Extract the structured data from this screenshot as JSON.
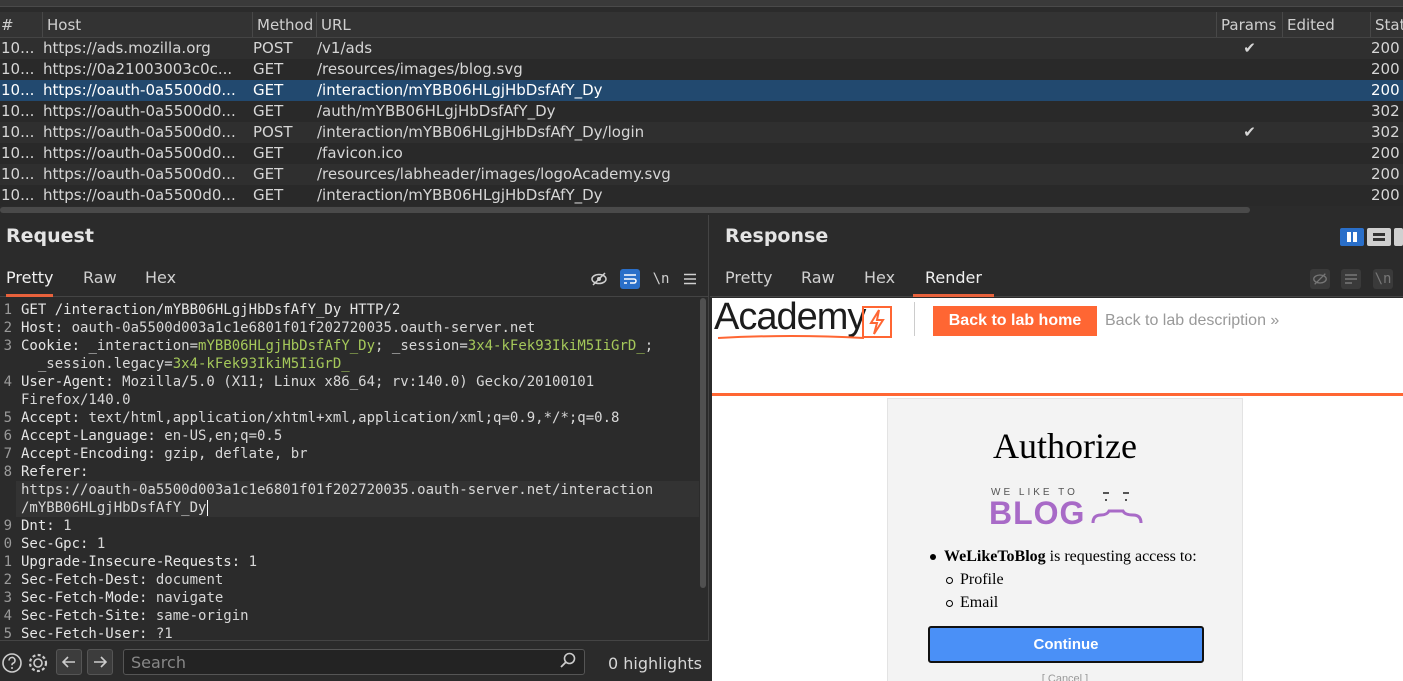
{
  "history": {
    "columns": [
      "#",
      "Host",
      "Method",
      "URL",
      "Params",
      "Edited",
      "Stat"
    ],
    "rows": [
      {
        "num": "10...",
        "host": "https://ads.mozilla.org",
        "method": "POST",
        "url": "/v1/ads",
        "params": "✔",
        "status": "200"
      },
      {
        "num": "10...",
        "host": "https://0a21003003c0c...",
        "method": "GET",
        "url": "/resources/images/blog.svg",
        "params": "",
        "status": "200"
      },
      {
        "num": "10...",
        "host": "https://oauth-0a5500d0...",
        "method": "GET",
        "url": "/interaction/mYBB06HLgjHbDsfAfY_Dy",
        "params": "",
        "status": "200"
      },
      {
        "num": "10...",
        "host": "https://oauth-0a5500d0...",
        "method": "GET",
        "url": "/auth/mYBB06HLgjHbDsfAfY_Dy",
        "params": "",
        "status": "302"
      },
      {
        "num": "10...",
        "host": "https://oauth-0a5500d0...",
        "method": "POST",
        "url": "/interaction/mYBB06HLgjHbDsfAfY_Dy/login",
        "params": "✔",
        "status": "302"
      },
      {
        "num": "10...",
        "host": "https://oauth-0a5500d0...",
        "method": "GET",
        "url": "/favicon.ico",
        "params": "",
        "status": "200"
      },
      {
        "num": "10...",
        "host": "https://oauth-0a5500d0...",
        "method": "GET",
        "url": "/resources/labheader/images/logoAcademy.svg",
        "params": "",
        "status": "200"
      },
      {
        "num": "10...",
        "host": "https://oauth-0a5500d0...",
        "method": "GET",
        "url": "/interaction/mYBB06HLgjHbDsfAfY_Dy",
        "params": "",
        "status": "200"
      }
    ]
  },
  "request": {
    "title": "Request",
    "tabs": [
      "Pretty",
      "Raw",
      "Hex"
    ],
    "newline_label": "\\n",
    "gutter": [
      "1",
      "2",
      "3",
      "",
      "4",
      "",
      "5",
      "6",
      "7",
      "8",
      "",
      "",
      "9",
      "0",
      "1",
      "2",
      "3",
      "4",
      "5"
    ],
    "lines": {
      "l1": "GET /interaction/mYBB06HLgjHbDsfAfY_Dy HTTP/2",
      "l2k": "Host:",
      "l2v": " oauth-0a5500d003a1c1e6801f01f202720035.oauth-server.net",
      "l3k": "Cookie:",
      "l3a": " _interaction=",
      "l3b": "mYBB06HLgjHbDsfAfY_Dy",
      "l3c": "; _session=",
      "l3d": "3x4-kFek93IkiM5IiGrD_",
      "l3e": ";",
      "l3f": "  _session.legacy=",
      "l3g": "3x4-kFek93IkiM5IiGrD_",
      "l4k": "User-Agent:",
      "l4v": " Mozilla/5.0 (X11; Linux x86_64; rv:140.0) Gecko/20100101",
      "l4b": "Firefox/140.0",
      "l5k": "Accept:",
      "l5v": " text/html,application/xhtml+xml,application/xml;q=0.9,*/*;q=0.8",
      "l6k": "Accept-Language:",
      "l6v": " en-US,en;q=0.5",
      "l7k": "Accept-Encoding:",
      "l7v": " gzip, deflate, br",
      "l8k": "Referer:",
      "l8a": "https://oauth-0a5500d003a1c1e6801f01f202720035.oauth-server.net/interaction",
      "l8b": "/mYBB06HLgjHbDsfAfY_Dy",
      "l9k": "Dnt:",
      "l9v": " 1",
      "l10k": "Sec-Gpc:",
      "l10v": " 1",
      "l11k": "Upgrade-Insecure-Requests:",
      "l11v": " 1",
      "l12k": "Sec-Fetch-Dest:",
      "l12v": " document",
      "l13k": "Sec-Fetch-Mode:",
      "l13v": " navigate",
      "l14k": "Sec-Fetch-Site:",
      "l14v": " same-origin",
      "l15k": "Sec-Fetch-User:",
      "l15v": " ?1"
    }
  },
  "footer": {
    "search_placeholder": "Search",
    "highlights": "0 highlights"
  },
  "response": {
    "title": "Response",
    "tabs": [
      "Pretty",
      "Raw",
      "Hex",
      "Render"
    ],
    "newline_label": "\\n"
  },
  "page": {
    "academy": "Academy",
    "back_home": "Back to lab home",
    "back_desc": "Back to lab description »",
    "auth_title": "Authorize",
    "blog_small": "WE LIKE TO",
    "blog_big": "BLOG",
    "client": "WeLikeToBlog",
    "requesting": " is requesting access to:",
    "scopes": [
      "Profile",
      "Email"
    ],
    "continue": "Continue",
    "cancel": "[ Cancel ]"
  },
  "colors": {
    "accent": "#e8623c",
    "selected_row": "#22496f",
    "cookie_value": "#a5c85a",
    "lab_orange": "#ff6633",
    "continue_blue": "#4a90f7",
    "blog_purple": "#a86ac7"
  }
}
